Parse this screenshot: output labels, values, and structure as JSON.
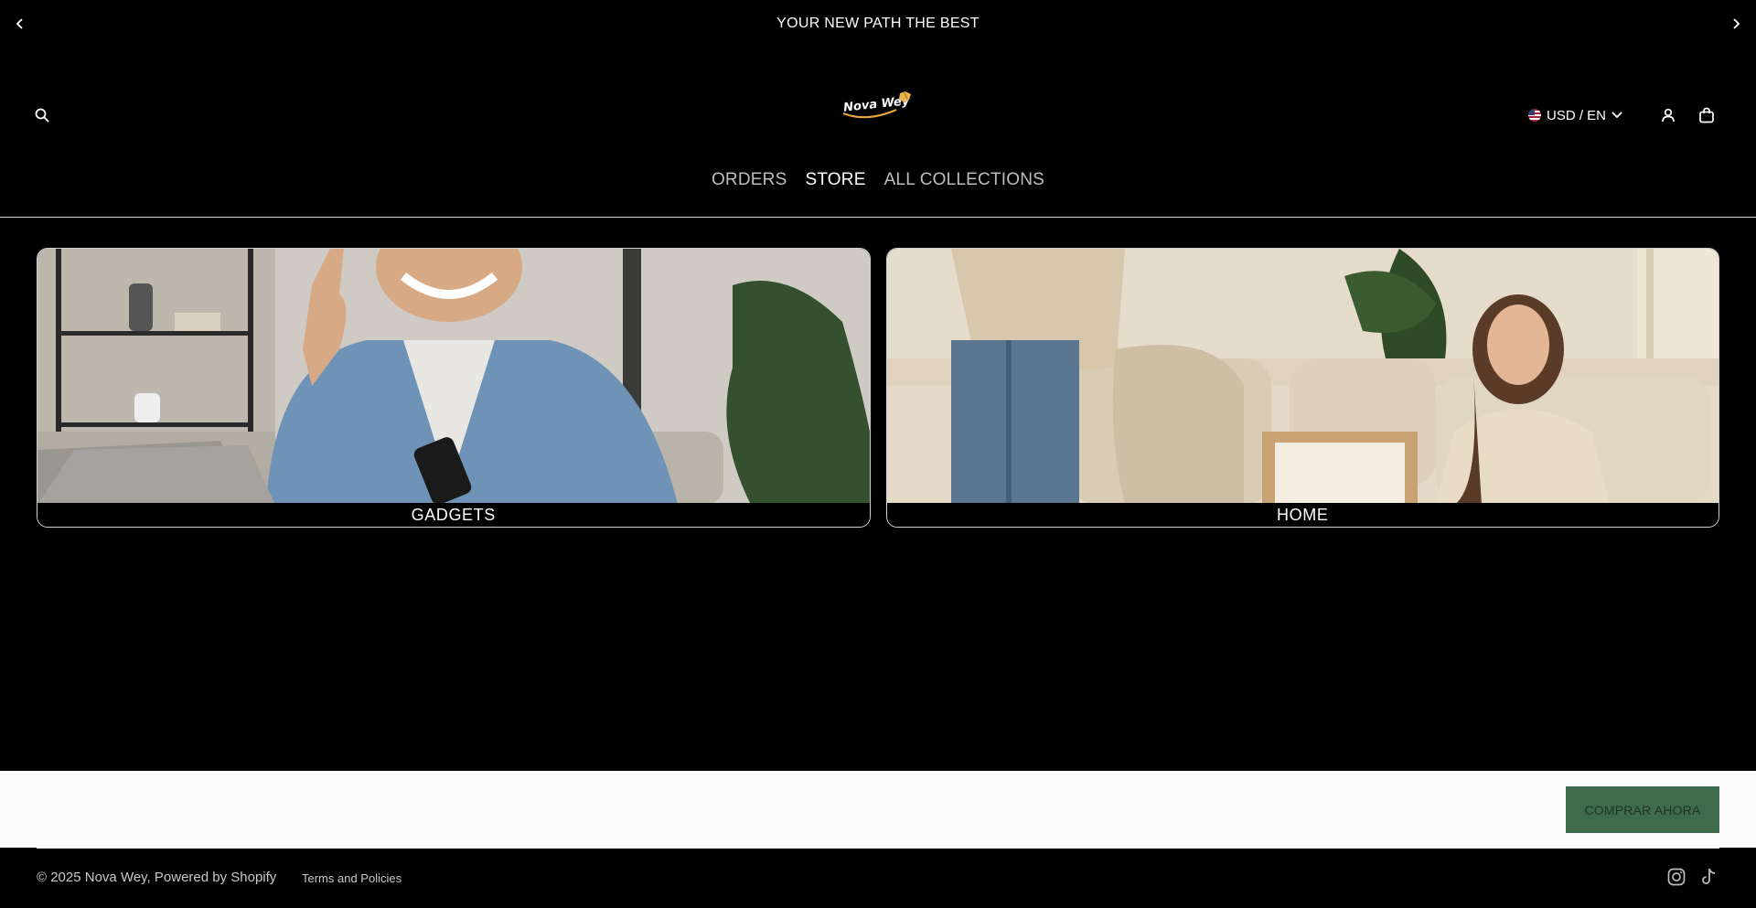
{
  "announcement": {
    "text": "YOUR NEW PATH THE BEST",
    "prev_icon": "chevron-left-icon",
    "next_icon": "chevron-right-icon"
  },
  "header": {
    "logo_text": "Nova Wey",
    "locale_label": "USD / EN",
    "icons": [
      "search-icon",
      "flag-us-icon",
      "chevron-down-icon",
      "account-icon",
      "cart-icon"
    ]
  },
  "nav": {
    "items": [
      {
        "label": "ORDERS",
        "active": false
      },
      {
        "label": "STORE",
        "active": true
      },
      {
        "label": "ALL COLLECTIONS",
        "active": false
      }
    ]
  },
  "collections": [
    {
      "label": "GADGETS"
    },
    {
      "label": "HOME"
    }
  ],
  "cta": {
    "label": "COMPRAR AHORA",
    "bg_color": "#3d6b4c"
  },
  "footer": {
    "copyright": "© 2025 Nova Wey, Powered by Shopify",
    "policies": "Terms and Policies",
    "social_icons": [
      "instagram-icon",
      "tiktok-icon"
    ]
  }
}
